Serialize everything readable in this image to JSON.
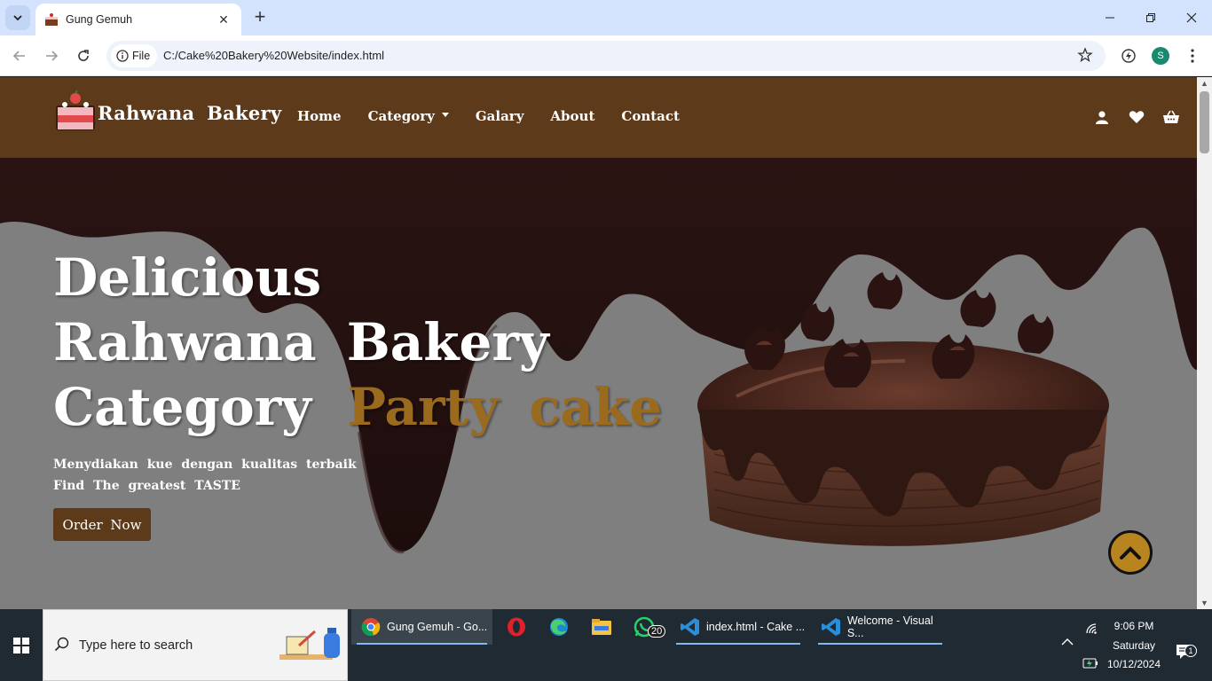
{
  "browser": {
    "tab_title": "Gung Gemuh",
    "chip_label": "File",
    "url": "C:/Cake%20Bakery%20Website/index.html",
    "profile_initial": "S"
  },
  "site": {
    "logo_text": "Rahwana  Bakery",
    "menu": [
      "Home",
      "Category",
      "Galary",
      "About",
      "Contact"
    ],
    "nav_icons": [
      "user-icon",
      "heart-icon",
      "basket-icon"
    ],
    "hero": {
      "line1": "Delicious",
      "line2": "Rahwana  Bakery",
      "line3_plain": "Category",
      "line3_accent": "Party  cake",
      "sub1": "Menydiakan kue dengan kualitas terbaik",
      "sub2": "Find The greatest TASTE",
      "cta": "Order  Now"
    },
    "colors": {
      "brand_brown": "#5c3a1a",
      "accent": "#9a6a1e",
      "hero_gray": "#7f7f7f",
      "to_top": "#b88420"
    }
  },
  "taskbar": {
    "search_placeholder": "Type here to search",
    "tasks": [
      {
        "label": "Gung Gemuh - Go...",
        "icon": "chrome-icon"
      },
      {
        "label": "",
        "icon": "opera-icon"
      },
      {
        "label": "",
        "icon": "edge-icon"
      },
      {
        "label": "",
        "icon": "file-explorer-icon"
      },
      {
        "label": "",
        "icon": "whatsapp-icon"
      },
      {
        "label": "index.html - Cake ...",
        "icon": "vscode-icon"
      },
      {
        "label": "Welcome - Visual S...",
        "icon": "vscode-icon"
      }
    ],
    "whatsapp_badge": "20",
    "time": "9:06 PM",
    "day": "Saturday",
    "date": "10/12/2024",
    "notification_count": "1"
  }
}
